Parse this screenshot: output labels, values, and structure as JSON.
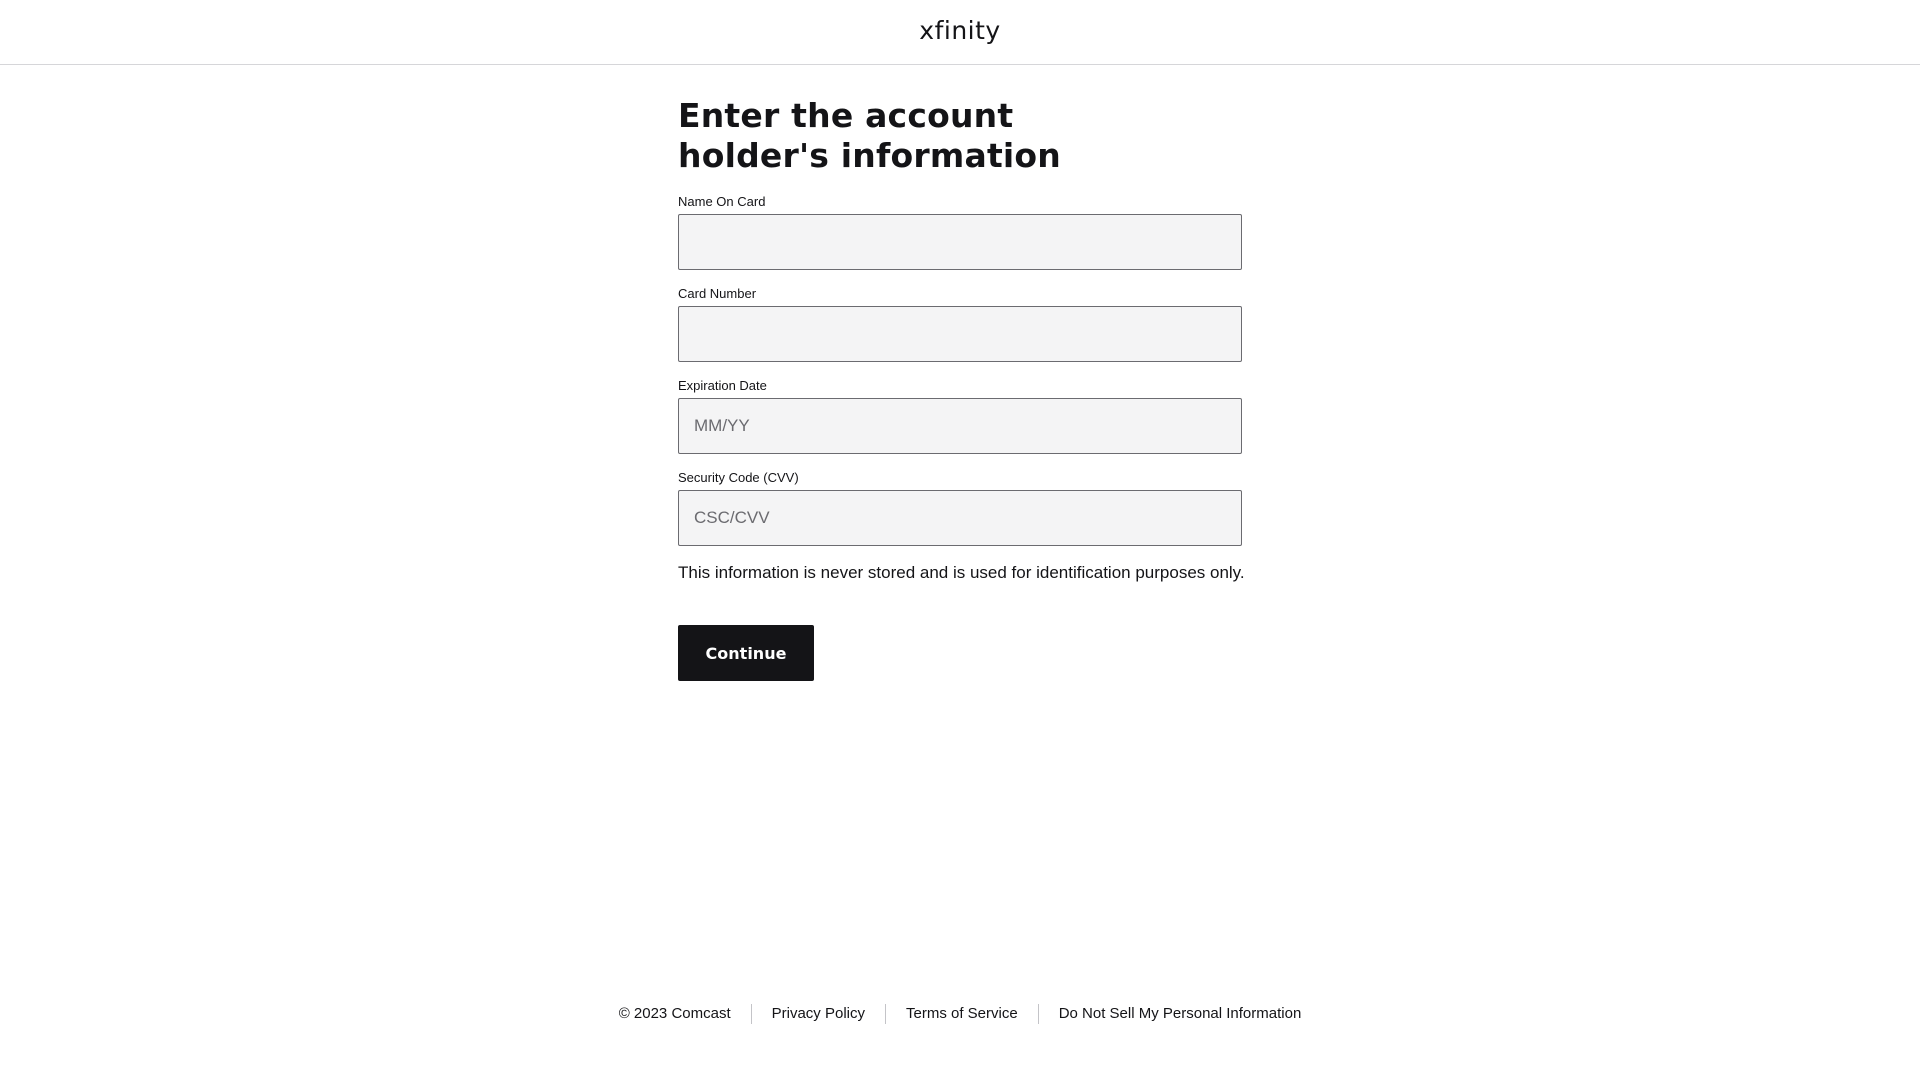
{
  "header": {
    "logo_text": "xfinity"
  },
  "form": {
    "title": "Enter the account holder's information",
    "fields": [
      {
        "label": "Name On Card",
        "value": "",
        "placeholder": ""
      },
      {
        "label": "Card Number",
        "value": "",
        "placeholder": ""
      },
      {
        "label": "Expiration Date",
        "value": "",
        "placeholder": "MM/YY"
      },
      {
        "label": "Security Code (CVV)",
        "value": "",
        "placeholder": "CSC/CVV"
      }
    ],
    "note": "This information is never stored and is used for identification purposes only.",
    "continue_label": "Continue"
  },
  "footer": {
    "copyright": "© 2023 Comcast",
    "links": [
      "Privacy Policy",
      "Terms of Service",
      "Do Not Sell My Personal Information"
    ]
  }
}
